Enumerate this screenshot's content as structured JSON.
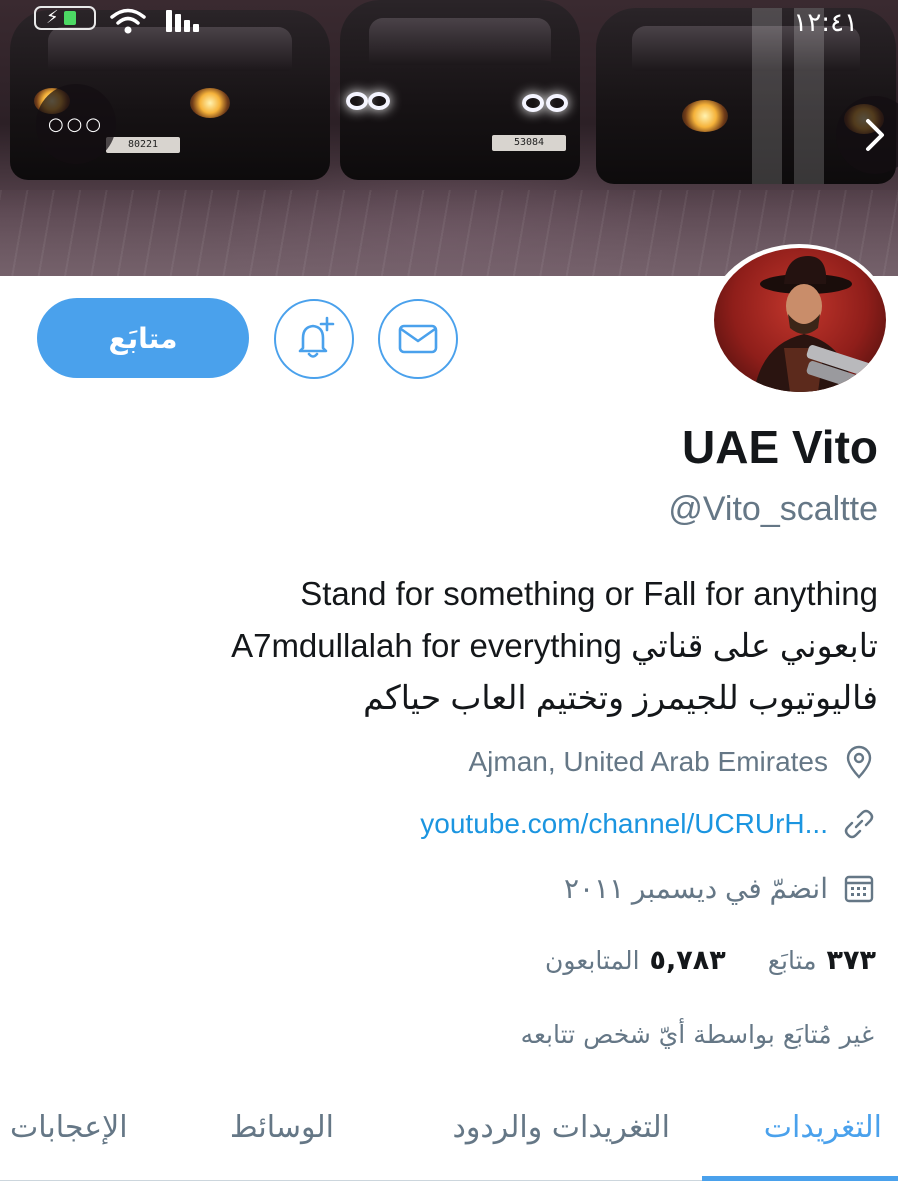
{
  "status_bar": {
    "time": "١٢:٤١"
  },
  "header": {
    "more_icon": "more-horizontal-icon",
    "next_icon": "chevron-right-icon",
    "plates": [
      "80221",
      "53084"
    ]
  },
  "actions": {
    "follow_label": "متابَع",
    "notify_icon": "bell-plus-icon",
    "message_icon": "envelope-icon"
  },
  "profile": {
    "display_name": "UAE Vito",
    "handle": "@Vito_scaltte",
    "bio_lines": [
      "Stand for something or Fall for anything",
      "A7mdullalah for everything تابعوني على قناتي",
      "فاليوتيوب للجيمرز وتختيم العاب حياكم"
    ],
    "location": "Ajman, United Arab Emirates",
    "website": "youtube.com/channel/UCRUrH...",
    "joined": "انضمّ في ديسمبر ٢٠١١"
  },
  "stats": {
    "following_count": "٣٧٣",
    "following_label": "متابَع",
    "followers_count": "٥,٧٨٣",
    "followers_label": "المتابعون"
  },
  "not_followed_text": "غير مُتابَع بواسطة أيّ شخص تتابعه",
  "tabs": [
    {
      "label": "التغريدات",
      "active": true
    },
    {
      "label": "التغريدات والردود",
      "active": false
    },
    {
      "label": "الوسائط",
      "active": false
    },
    {
      "label": "الإعجابات",
      "active": false
    }
  ],
  "colors": {
    "accent": "#4aa1ec",
    "link": "#1b95e0",
    "secondary_text": "#657786"
  }
}
